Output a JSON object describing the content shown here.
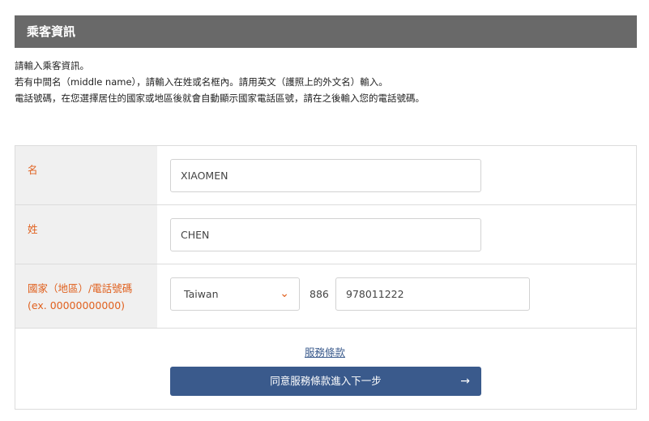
{
  "section": {
    "title": "乘客資訊"
  },
  "instructions": [
    "請輸入乘客資訊。",
    "若有中間名（middle name），請輸入在姓或名框內。請用英文（護照上的外文名）輸入。",
    "電話號碼，在您選擇居住的國家或地區後就會自動顯示國家電話區號，請在之後輸入您的電話號碼。"
  ],
  "form": {
    "first_name": {
      "label": "名",
      "value": "XIAOMEN"
    },
    "last_name": {
      "label": "姓",
      "value": "CHEN"
    },
    "phone": {
      "label": "國家（地區）/電話號碼",
      "hint": "(ex. 00000000000)",
      "country": "Taiwan",
      "dial_code": "886",
      "number": "978011222"
    }
  },
  "terms_link": "服務條款",
  "agree_button": {
    "label": "同意服務條款進入下一步",
    "icon": "arrow-right-icon"
  },
  "colors": {
    "header_bg": "#696969",
    "label_text": "#e0611f",
    "button_bg": "#3a5a8c",
    "link": "#3a5a8c"
  }
}
